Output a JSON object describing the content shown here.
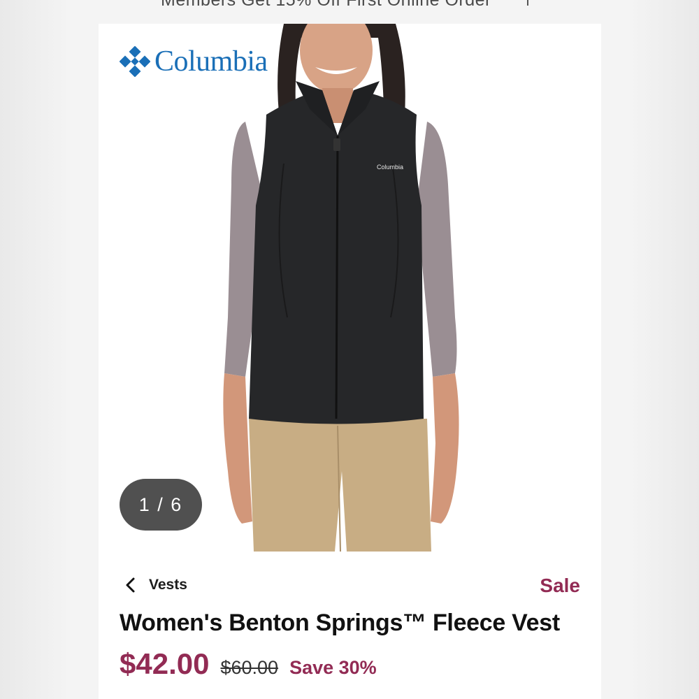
{
  "promo": {
    "text": "Members Get 15% Off First Online Order"
  },
  "brand": {
    "name": "Columbia",
    "logo_color": "#1a6fb7"
  },
  "gallery": {
    "counter": "1 / 6",
    "vest_logo_text": "Columbia"
  },
  "breadcrumb": {
    "label": "Vests",
    "icon": "chevron-left-icon"
  },
  "product": {
    "sale_badge": "Sale",
    "title": "Women's Benton Springs™ Fleece Vest",
    "price_current": "$42.00",
    "price_original": "$60.00",
    "price_save": "Save 30%"
  },
  "colors": {
    "sale_accent": "#922b54"
  }
}
